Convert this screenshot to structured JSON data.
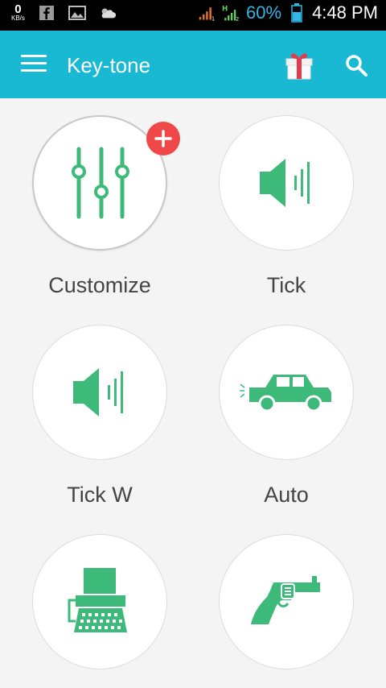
{
  "status_bar": {
    "net_speed_value": "0",
    "net_speed_unit": "KB/s",
    "battery_percent": "60%",
    "time": "4:48 PM",
    "network_type": "H"
  },
  "app_bar": {
    "title": "Key-tone",
    "accent_color": "#19b9d4"
  },
  "tiles": [
    {
      "label": "Customize",
      "icon": "equalizer-icon"
    },
    {
      "label": "Tick",
      "icon": "speaker-icon"
    },
    {
      "label": "Tick W",
      "icon": "speaker-icon"
    },
    {
      "label": "Auto",
      "icon": "car-icon"
    },
    {
      "label": "",
      "icon": "typewriter-icon"
    },
    {
      "label": "",
      "icon": "revolver-icon"
    }
  ],
  "colors": {
    "icon_green": "#3dba7a",
    "badge_red": "#f04848",
    "background": "#f4f4f4"
  }
}
